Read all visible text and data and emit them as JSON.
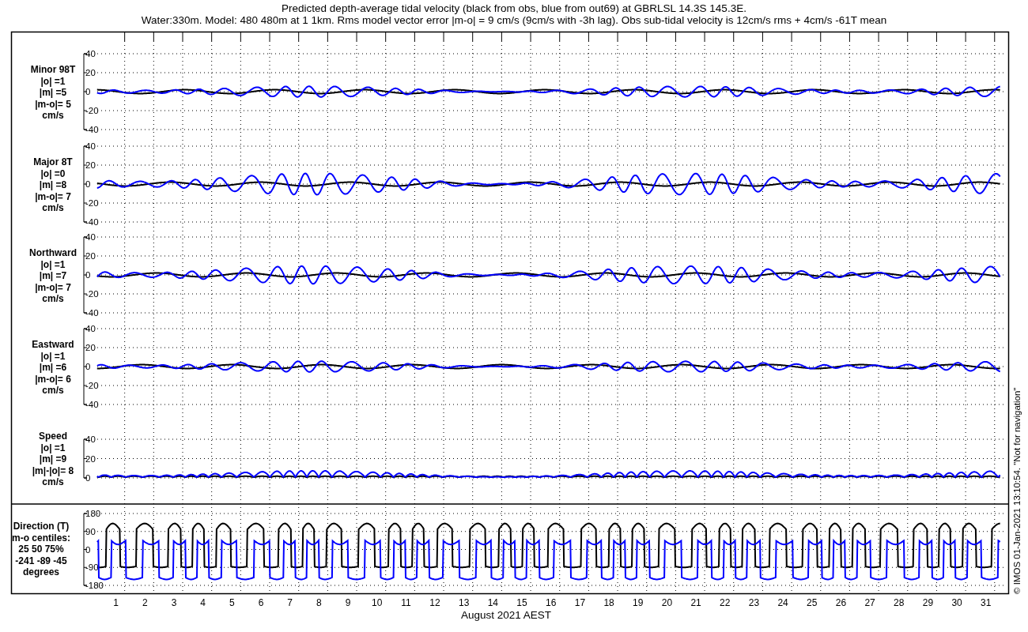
{
  "title_lines": [
    "Predicted depth-average tidal velocity (black from obs, blue from out69) at GBRLSL 14.3S 145.3E.",
    "Water:330m. Model: 480 480m at 1 1km. Rms model vector error |m-o| = 9 cm/s (9cm/s with -3h lag). Obs sub-tidal velocity is 12cm/s rms + 4cm/s -61T mean"
  ],
  "panels": [
    {
      "kind": "velocity",
      "label_lines": [
        "Minor 98T",
        "|o| =1",
        "|m| =5",
        "|m-o|= 5",
        "cm/s"
      ],
      "yticks": [
        "40",
        "20",
        "0",
        "-20",
        "-40"
      ]
    },
    {
      "kind": "velocity",
      "label_lines": [
        "Major 8T",
        "|o| =0",
        "|m| =8",
        "|m-o|= 7",
        "cm/s"
      ],
      "yticks": [
        "40",
        "20",
        "0",
        "-20",
        "-40"
      ]
    },
    {
      "kind": "velocity",
      "label_lines": [
        "Northward",
        "|o| =1",
        "|m| =7",
        "|m-o|= 7",
        "cm/s"
      ],
      "yticks": [
        "40",
        "20",
        "0",
        "-20",
        "-40"
      ]
    },
    {
      "kind": "velocity",
      "label_lines": [
        "Eastward",
        "|o| =1",
        "|m| =6",
        "|m-o|= 6",
        "cm/s"
      ],
      "yticks": [
        "40",
        "20",
        "0",
        "-20",
        "-40"
      ]
    },
    {
      "kind": "speed",
      "label_lines": [
        "Speed",
        "|o| =1",
        "|m| =9",
        "|m|-|o|= 8",
        "cm/s"
      ],
      "yticks": [
        "40",
        "20",
        "0"
      ]
    },
    {
      "kind": "direction",
      "label_lines": [
        "Direction (T)",
        "m-o centiles:",
        "25  50  75%",
        "-241  -89  -45",
        "degrees"
      ],
      "yticks": [
        "180",
        "90",
        "0",
        "-90",
        "-180"
      ]
    }
  ],
  "x_axis": {
    "day_labels": [
      "1",
      "2",
      "3",
      "4",
      "5",
      "6",
      "7",
      "8",
      "9",
      "10",
      "11",
      "12",
      "13",
      "14",
      "15",
      "16",
      "17",
      "18",
      "19",
      "20",
      "21",
      "22",
      "23",
      "24",
      "25",
      "26",
      "27",
      "28",
      "29",
      "30",
      "31"
    ],
    "label": "August 2021 AEST"
  },
  "credit": "© IMOS 01-Jan-2021 13:10:54.  \"Not for navigation\""
}
